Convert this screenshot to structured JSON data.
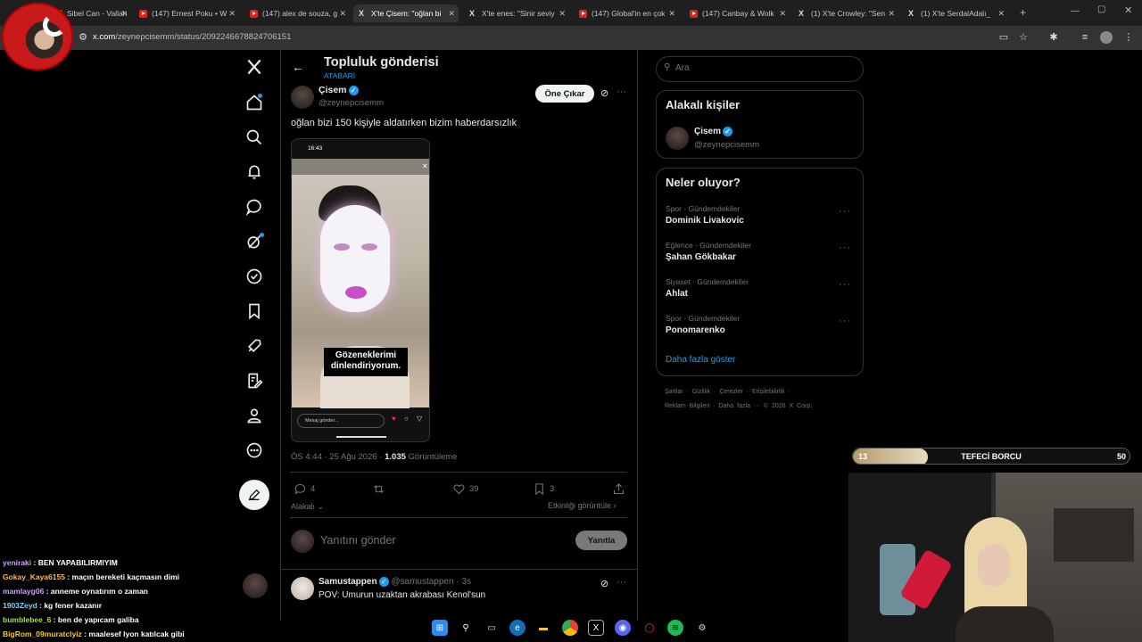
{
  "browser": {
    "tabs": [
      {
        "label": "Sibel Can - Vallah",
        "icon": "youtube-icon"
      },
      {
        "label": "(147) Ernest Poku • W",
        "icon": "youtube-icon"
      },
      {
        "label": "(147) alex de souza, g",
        "icon": "youtube-icon"
      },
      {
        "label": "X'te Çisem: \"oğlan bi",
        "icon": "x-icon",
        "active": true
      },
      {
        "label": "X'te enes: \"Sinir seviy",
        "icon": "x-icon"
      },
      {
        "label": "(147) Global'in en çok",
        "icon": "youtube-icon"
      },
      {
        "label": "(147) Canbay & Wolk",
        "icon": "youtube-icon"
      },
      {
        "label": "(1) X'te Crowley: \"Sen",
        "icon": "x-icon"
      },
      {
        "label": "(1) X'te SerdalAdalı_",
        "icon": "x-icon"
      }
    ],
    "url_host": "x.com",
    "url_path": "/zeynepcisemm/status/2092246678824706151"
  },
  "post_header": {
    "title": "Topluluk gönderisi",
    "subtitle": "ATABARI"
  },
  "post": {
    "author": "Çisem",
    "handle": "@zeynepcisemm",
    "feature_button": "Öne Çıkar",
    "text": "oğlan bizi 150 kişiyle aldatırken bizim haberdarsızlık",
    "media": {
      "status_time": "16:43",
      "caption_line1": "Gözeneklerimi",
      "caption_line2": "dinlendiriyorum.",
      "reply_placeholder": "Mesaj gönder..."
    },
    "timestamp": "ÖS 4:44 · 25 Ağu 2026 ·",
    "views_count": "1.035",
    "views_label": "Görüntüleme",
    "replies": "4",
    "reposts": "",
    "likes": "39",
    "bookmarks": "3",
    "relevance": "Alakalı",
    "activity": "Etkinliği görüntüle"
  },
  "reply_box": {
    "placeholder": "Yanıtını gönder",
    "button": "Yanıtla"
  },
  "reply": {
    "author": "Samustappen",
    "handle": "@samustappen",
    "time": "· 3s",
    "text": "POV: Umurun uzaktan akrabası Kenol'sun"
  },
  "sidebar": {
    "search_placeholder": "Ara",
    "related_title": "Alakalı kişiler",
    "related_name": "Çisem",
    "related_handle": "@zeynepcisemm",
    "trends_title": "Neler oluyor?",
    "trends": [
      {
        "category": "Spor · Gündemdekiler",
        "name": "Dominik Livakovic"
      },
      {
        "category": "Eğlence · Gündemdekiler",
        "name": "Şahan Gökbakar"
      },
      {
        "category": "Siyaset · Gündemdekiler",
        "name": "Ahlat"
      },
      {
        "category": "Spor · Gündemdekiler",
        "name": "Ponomarenko"
      }
    ],
    "show_more": "Daha fazla göster",
    "footer_line1": [
      "Şartlar",
      "Gizlilik",
      "Çerezler",
      "Erişilebilirlik"
    ],
    "footer_line2": [
      "Reklam Bilgileri",
      "Daha fazla ···",
      "© 2026 X Corp."
    ]
  },
  "overlay": {
    "bar_left": "13",
    "bar_title": "TEFECİ BORCU",
    "bar_right": "50",
    "progress_fraction": 0.27
  },
  "chat": [
    {
      "user": "yeniraki",
      "msg": ": BEN YAPABILIRMIYIM",
      "color": "#c9a0ff"
    },
    {
      "user": "Gokay_Kaya6155",
      "msg": ": maçın bereketi kaçmasın dimi",
      "color": "#ffb84d"
    },
    {
      "user": "mamlayg06",
      "msg": ": anneme oynatırım o zaman",
      "color": "#c9a0ff"
    },
    {
      "user": "1903Zeyd",
      "msg": ": kg fener kazanır",
      "color": "#7dd3fc"
    },
    {
      "user": "bumblebee_6",
      "msg": ": ben de yapıcam galiba",
      "color": "#a3e635"
    },
    {
      "user": "BigRom_09muratclyiz",
      "msg": ": maalesef lyon katılcak gibi",
      "color": "#facc15"
    }
  ]
}
